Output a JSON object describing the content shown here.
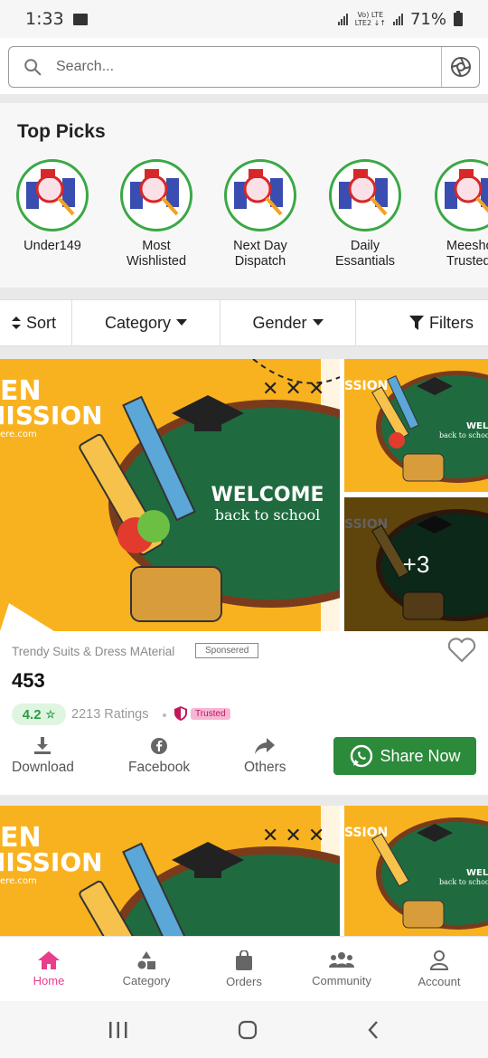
{
  "status": {
    "time": "1:33",
    "battery": "71%",
    "network_line1": "Vo) LTE",
    "network_line2": "LTE2 ↓↑"
  },
  "search": {
    "placeholder": "Search..."
  },
  "top_picks": {
    "title": "Top Picks",
    "items": [
      {
        "label": "Under149"
      },
      {
        "label": "Most\nWishlisted"
      },
      {
        "label": "Next Day\nDispatch"
      },
      {
        "label": "Daily\nEssantials"
      },
      {
        "label": "Meesho\nTrusted"
      }
    ]
  },
  "filters": {
    "sort": "Sort",
    "category": "Category",
    "gender": "Gender",
    "filters": "Filters"
  },
  "product": {
    "banner_line1": "WELCOME",
    "banner_line2": "back to school",
    "banner_left_1": "EN",
    "banner_left_2": "IISSION",
    "banner_left_3": "ere.com",
    "more_images": "+3",
    "seller": "Trendy Suits & Dress MAterial",
    "sponsored": "Sponsered",
    "price": "453",
    "rating": "4.2",
    "ratings_count": "2213 Ratings",
    "trusted": "Trusted",
    "actions": {
      "download": "Download",
      "facebook": "Facebook",
      "others": "Others",
      "share": "Share Now"
    }
  },
  "bottom_nav": [
    {
      "label": "Home"
    },
    {
      "label": "Category"
    },
    {
      "label": "Orders"
    },
    {
      "label": "Community"
    },
    {
      "label": "Account"
    }
  ],
  "colors": {
    "accent": "#e83e8c",
    "share_green": "#2c8a3b",
    "banner_yellow": "#f9b21f",
    "board_green": "#1f6b3f"
  }
}
